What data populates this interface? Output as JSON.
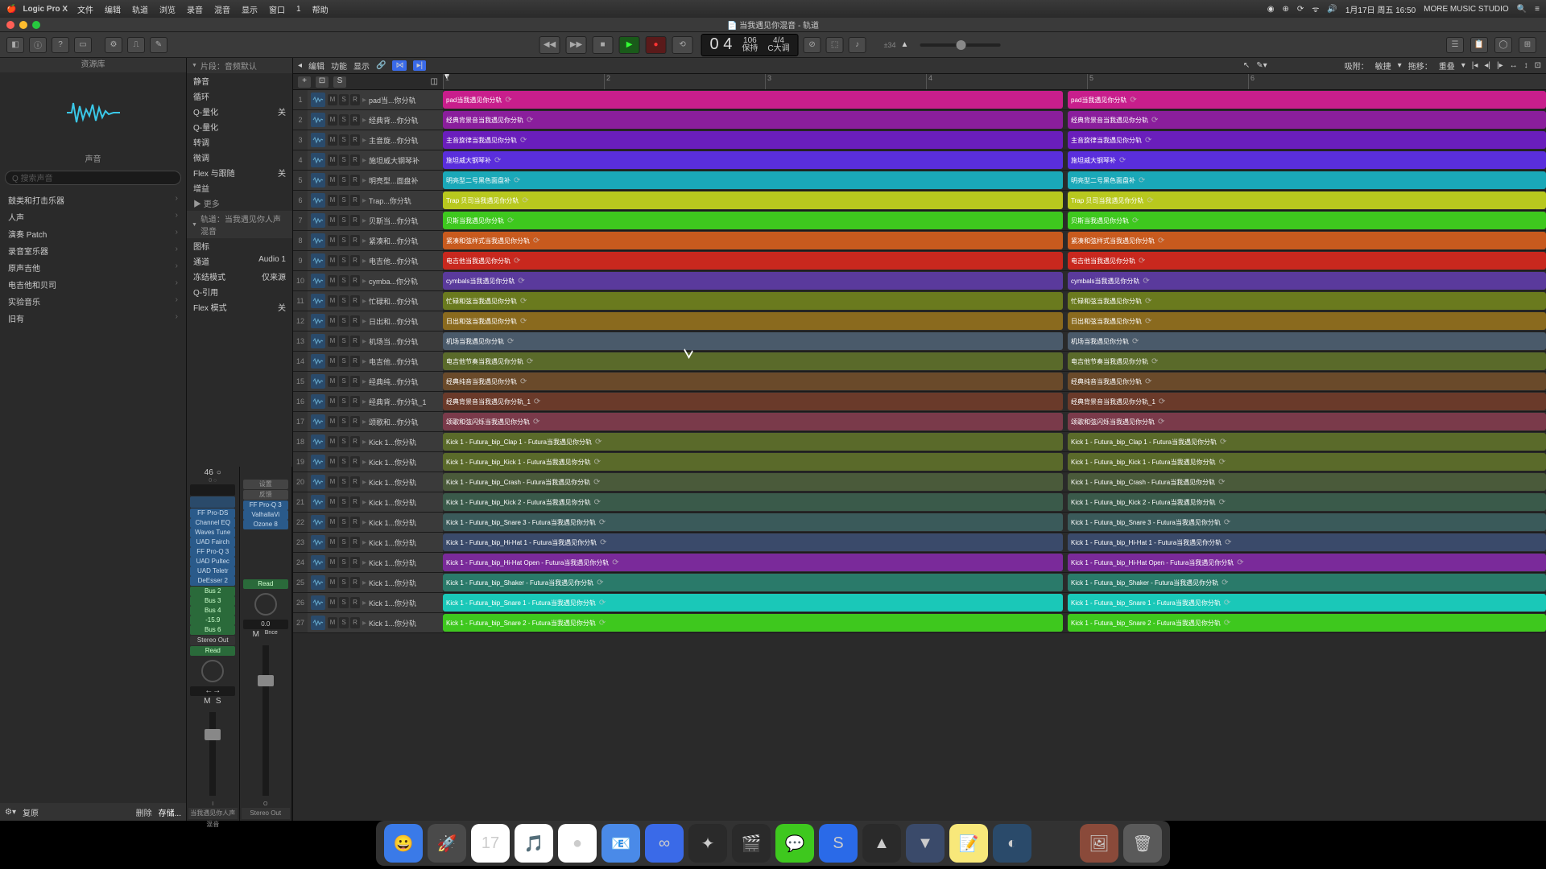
{
  "menubar": {
    "app": "Logic Pro X",
    "items": [
      "文件",
      "编辑",
      "轨道",
      "浏览",
      "录音",
      "混音",
      "显示",
      "窗口",
      "1",
      "帮助"
    ],
    "right": {
      "date": "1月17日 周五 16:50",
      "studio": "MORE MUSIC STUDIO"
    }
  },
  "titlebar": {
    "title": "当我遇见你混音 - 轨道"
  },
  "toolbar": {
    "position": "0 4",
    "tempo": "106",
    "tsig": "4/4",
    "key": "C大调",
    "beat": "保持",
    "zoom": "±34"
  },
  "library": {
    "hdr": "资源库",
    "hdr2": "声音",
    "search": "Q 搜索声音",
    "cats": [
      "鼓类和打击乐器",
      "人声",
      "演奏 Patch",
      "录音室乐器",
      "原声吉他",
      "电吉他和贝司",
      "实验音乐",
      "旧有"
    ],
    "footer": {
      "revert": "复原",
      "delete": "删除",
      "save": "存储..."
    }
  },
  "inspector": {
    "sec1": "片段：音频默认",
    "rows1": [
      [
        "静音",
        ""
      ],
      [
        "循环",
        ""
      ],
      [
        "Q-量化",
        "关"
      ],
      [
        "Q-量化",
        ""
      ],
      [
        "转调",
        ""
      ],
      [
        "微调",
        ""
      ],
      [
        "Flex 与跟随",
        "关"
      ],
      [
        "增益",
        ""
      ]
    ],
    "more": "▶ 更多",
    "sec2": "轨道：当我遇见你人声混音",
    "rows2": [
      [
        "图标",
        ""
      ],
      [
        "通道",
        "Audio 1"
      ],
      [
        "冻结模式",
        "仅来源"
      ],
      [
        "Q-引用",
        ""
      ],
      [
        "Flex 模式",
        "关"
      ]
    ],
    "ch1": {
      "pan": "46",
      "inserts": [
        "FF Pro-DS",
        "Channel EQ",
        "Waves Tune",
        "UAD Fairch",
        "FF Pro-Q 3",
        "UAD Pultec",
        "UAD Teletr",
        "DeEsser 2"
      ],
      "sends": [
        "Bus 2",
        "Bus 3",
        "Bus 4",
        "-15.9",
        "Bus 6"
      ],
      "out": "Stereo Out",
      "read": "Read",
      "vol": "",
      "name": "当我遇见你人声混音"
    },
    "ch2": {
      "inserts": [
        "FF Pro-Q 3",
        "ValhallaVi",
        "Ozone 8"
      ],
      "read": "Read",
      "vol": "0.0",
      "name": "Stereo Out",
      "bnce": "Bnce"
    }
  },
  "trackbar": {
    "edit": "编辑",
    "func": "功能",
    "view": "显示",
    "snap": "吸附：",
    "drag": "拖移：",
    "sens": "敏捷",
    "overlap": "重叠"
  },
  "ruler": [
    "1",
    "2",
    "3",
    "4",
    "5",
    "6"
  ],
  "tracks": [
    {
      "n": 1,
      "name": "pad当...你分轨",
      "r1": "pad当我遇见你分轨",
      "r2": "pad当我遇见你分轨",
      "c": "#c81e8c"
    },
    {
      "n": 2,
      "name": "经典背...你分轨",
      "r1": "经典背景音当我遇见你分轨",
      "r2": "经典背景音当我遇见你分轨",
      "c": "#8a1e9c"
    },
    {
      "n": 3,
      "name": "主音旋...你分轨",
      "r1": "主音旋律当我遇见你分轨",
      "r2": "主音旋律当我遇见你分轨",
      "c": "#6a1ebc"
    },
    {
      "n": 4,
      "name": "施坦威大钢琴补",
      "r1": "施坦威大钢琴补",
      "r2": "施坦威大钢琴补",
      "c": "#5a2edc"
    },
    {
      "n": 5,
      "name": "明亮型...面盘补",
      "r1": "明亮型二号黑色面盘补",
      "r2": "明亮型二号黑色面盘补",
      "c": "#1aa8b8"
    },
    {
      "n": 6,
      "name": "Trap...你分轨",
      "r1": "Trap 贝司当我遇见你分轨",
      "r2": "Trap 贝司当我遇见你分轨",
      "c": "#b8c81e"
    },
    {
      "n": 7,
      "name": "贝斯当...你分轨",
      "r1": "贝斯当我遇见你分轨",
      "r2": "贝斯当我遇见你分轨",
      "c": "#3ec81e"
    },
    {
      "n": 8,
      "name": "紧凑和...你分轨",
      "r1": "紧凑和弦样式当我遇见你分轨",
      "r2": "紧凑和弦样式当我遇见你分轨",
      "c": "#c85a1e"
    },
    {
      "n": 9,
      "name": "电吉他...你分轨",
      "r1": "电吉他当我遇见你分轨",
      "r2": "电吉他当我遇见你分轨",
      "c": "#c8281e"
    },
    {
      "n": 10,
      "name": "cymba...你分轨",
      "r1": "cymbals当我遇见你分轨",
      "r2": "cymbals当我遇见你分轨",
      "c": "#5a3a9c"
    },
    {
      "n": 11,
      "name": "忙碌和...你分轨",
      "r1": "忙碌和弦当我遇见你分轨",
      "r2": "忙碌和弦当我遇见你分轨",
      "c": "#6a7a1e"
    },
    {
      "n": 12,
      "name": "日出和...你分轨",
      "r1": "日出和弦当我遇见你分轨",
      "r2": "日出和弦当我遇见你分轨",
      "c": "#8a6a1e"
    },
    {
      "n": 13,
      "name": "机场当...你分轨",
      "r1": "机场当我遇见你分轨",
      "r2": "机场当我遇见你分轨",
      "c": "#4a5a6a"
    },
    {
      "n": 14,
      "name": "电吉他...你分轨",
      "r1": "电吉他节奏当我遇见你分轨",
      "r2": "电吉他节奏当我遇见你分轨",
      "c": "#5a6a2a"
    },
    {
      "n": 15,
      "name": "经典纯...你分轨",
      "r1": "经典纯音当我遇见你分轨",
      "r2": "经典纯音当我遇见你分轨",
      "c": "#6a4a2a"
    },
    {
      "n": 16,
      "name": "经典背...你分轨_1",
      "r1": "经典背景音当我遇见你分轨_1",
      "r2": "经典背景音当我遇见你分轨_1",
      "c": "#6a3a2a"
    },
    {
      "n": 17,
      "name": "颂歌和...你分轨",
      "r1": "颂歌和弦闪烁当我遇见你分轨",
      "r2": "颂歌和弦闪烁当我遇见你分轨",
      "c": "#7a3a4a"
    },
    {
      "n": 18,
      "name": "Kick 1...你分轨",
      "r1": "Kick 1 - Futura_bip_Clap 1 - Futura当我遇见你分轨",
      "r2": "Kick 1 - Futura_bip_Clap 1 - Futura当我遇见你分轨",
      "c": "#5a6a2a"
    },
    {
      "n": 19,
      "name": "Kick 1...你分轨",
      "r1": "Kick 1 - Futura_bip_Kick 1 - Futura当我遇见你分轨",
      "r2": "Kick 1 - Futura_bip_Kick 1 - Futura当我遇见你分轨",
      "c": "#5a6a2a"
    },
    {
      "n": 20,
      "name": "Kick 1...你分轨",
      "r1": "Kick 1 - Futura_bip_Crash - Futura当我遇见你分轨",
      "r2": "Kick 1 - Futura_bip_Crash - Futura当我遇见你分轨",
      "c": "#4a5a3a"
    },
    {
      "n": 21,
      "name": "Kick 1...你分轨",
      "r1": "Kick 1 - Futura_bip_Kick 2 - Futura当我遇见你分轨",
      "r2": "Kick 1 - Futura_bip_Kick 2 - Futura当我遇见你分轨",
      "c": "#3a5a4a"
    },
    {
      "n": 22,
      "name": "Kick 1...你分轨",
      "r1": "Kick 1 - Futura_bip_Snare 3 - Futura当我遇见你分轨",
      "r2": "Kick 1 - Futura_bip_Snare 3 - Futura当我遇见你分轨",
      "c": "#3a5a5a"
    },
    {
      "n": 23,
      "name": "Kick 1...你分轨",
      "r1": "Kick 1 - Futura_bip_Hi-Hat 1 - Futura当我遇见你分轨",
      "r2": "Kick 1 - Futura_bip_Hi-Hat 1 - Futura当我遇见你分轨",
      "c": "#3a4a6a"
    },
    {
      "n": 24,
      "name": "Kick 1...你分轨",
      "r1": "Kick 1 - Futura_bip_Hi-Hat Open - Futura当我遇见你分轨",
      "r2": "Kick 1 - Futura_bip_Hi-Hat Open - Futura当我遇见你分轨",
      "c": "#7a2a9a"
    },
    {
      "n": 25,
      "name": "Kick 1...你分轨",
      "r1": "Kick 1 - Futura_bip_Shaker - Futura当我遇见你分轨",
      "r2": "Kick 1 - Futura_bip_Shaker - Futura当我遇见你分轨",
      "c": "#2a7a6a"
    },
    {
      "n": 26,
      "name": "Kick 1...你分轨",
      "r1": "Kick 1 - Futura_bip_Snare 1 - Futura当我遇见你分轨",
      "r2": "Kick 1 - Futura_bip_Snare 1 - Futura当我遇见你分轨",
      "c": "#1ac8b8"
    },
    {
      "n": 27,
      "name": "Kick 1...你分轨",
      "r1": "Kick 1 - Futura_bip_Snare 2 - Futura当我遇见你分轨",
      "r2": "Kick 1 - Futura_bip_Snare 2 - Futura当我遇见你分轨",
      "c": "#3ec81e"
    }
  ],
  "dock": [
    {
      "c": "#3a7ae8",
      "t": "😀"
    },
    {
      "c": "#4a4a4a",
      "t": "🚀"
    },
    {
      "c": "#fff",
      "t": "17"
    },
    {
      "c": "#fff",
      "t": "🎵"
    },
    {
      "c": "#fff",
      "t": "●"
    },
    {
      "c": "#4a8ae8",
      "t": "📧"
    },
    {
      "c": "#3a6ae8",
      "t": "∞"
    },
    {
      "c": "#2a2a2a",
      "t": "✦"
    },
    {
      "c": "#2a2a2a",
      "t": "🎬"
    },
    {
      "c": "#3ec81e",
      "t": "💬"
    },
    {
      "c": "#2a6ae8",
      "t": "S"
    },
    {
      "c": "#2a2a2a",
      "t": "▲"
    },
    {
      "c": "#3a4a6a",
      "t": "▼"
    },
    {
      "c": "#f8e87a",
      "t": "📝"
    },
    {
      "c": "#2a4a6a",
      "t": "◐"
    },
    {
      "c": "",
      "t": ""
    },
    {
      "c": "#8a4a3a",
      "t": "🖼"
    },
    {
      "c": "#5a5a5a",
      "t": "🗑"
    }
  ]
}
